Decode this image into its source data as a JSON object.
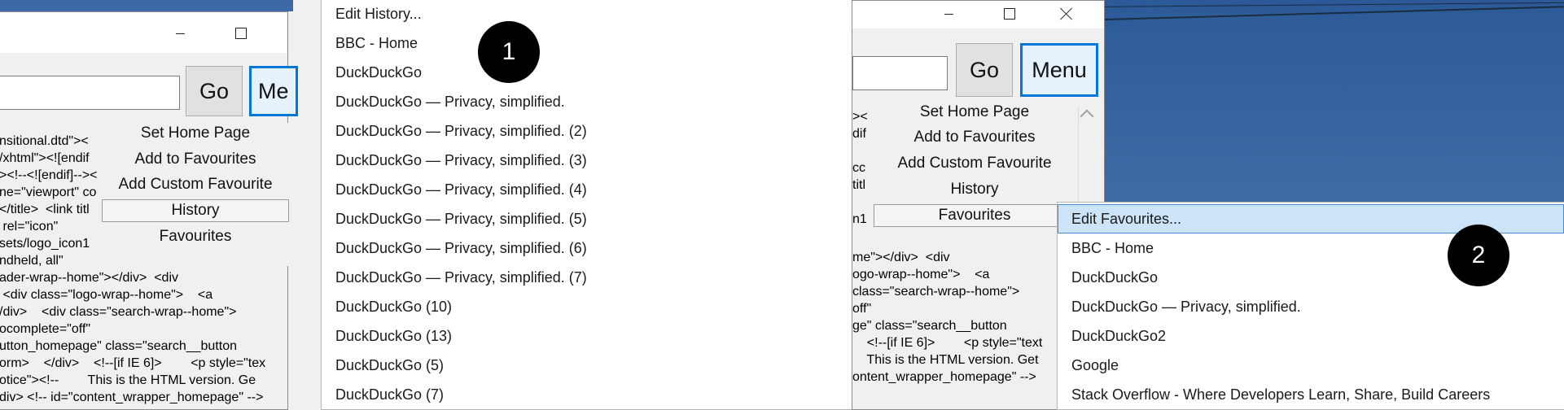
{
  "left_window": {
    "go_label": "Go",
    "menu_label_partial": "Me",
    "menu": {
      "items": [
        "Set Home Page",
        "Add to Favourites",
        "Add Custom Favourite",
        "History",
        "Favourites"
      ]
    },
    "source_text": "nsitional.dtd\"><\n/xhtml\"><![endif\n><!--<![endif]--><\nne=\"viewport\" co\n</title>  <link titl\n rel=\"icon\"\nsets/logo_icon1\nndheld, all\"\nader-wrap--home\"></div>  <div\n <div class=\"logo-wrap--home\">    <a\n/div>    <div class=\"search-wrap--home\">\nocomplete=\"off\"\nutton_homepage\" class=\"search__button\norm>    </div>    <!--[if IE 6]>        <p style=\"tex\notice\"><!--        This is the HTML version. Ge\ndiv> <!-- id=\"content_wrapper_homepage\" -->"
  },
  "history_dropdown": {
    "items": [
      "Edit History...",
      "BBC - Home",
      "DuckDuckGo",
      "DuckDuckGo — Privacy, simplified.",
      "DuckDuckGo — Privacy, simplified. (2)",
      "DuckDuckGo — Privacy, simplified. (3)",
      "DuckDuckGo — Privacy, simplified. (4)",
      "DuckDuckGo — Privacy, simplified. (5)",
      "DuckDuckGo — Privacy, simplified. (6)",
      "DuckDuckGo — Privacy, simplified. (7)",
      "DuckDuckGo (10)",
      "DuckDuckGo (13)",
      "DuckDuckGo (5)",
      "DuckDuckGo (7)"
    ]
  },
  "right_window": {
    "go_label": "Go",
    "menu_label": "Menu",
    "menu": {
      "items": [
        "Set Home Page",
        "Add to Favourites",
        "Add Custom Favourite",
        "History",
        "Favourites"
      ]
    },
    "source_left_text": "><\ndif\n\ncc\ntitl\n\nn1",
    "source_text": "me\"></div>  <div\nogo-wrap--home\">    <a\nclass=\"search-wrap--home\">\noff\"\nge\" class=\"search__button\n    <!--[if IE 6]>        <p style=\"text\n    This is the HTML version. Get\nontent_wrapper_homepage\" -->"
  },
  "favourites_dropdown": {
    "items": [
      "Edit Favourites...",
      "BBC - Home",
      "DuckDuckGo",
      "DuckDuckGo — Privacy, simplified.",
      "DuckDuckGo2",
      "Google",
      "Stack Overflow - Where Developers Learn, Share,  Build Careers"
    ]
  },
  "callouts": {
    "one": "1",
    "two": "2"
  },
  "colors": {
    "highlight": "#cce4f7",
    "focus_border": "#0078d7",
    "desktop": "#3c68a4"
  }
}
